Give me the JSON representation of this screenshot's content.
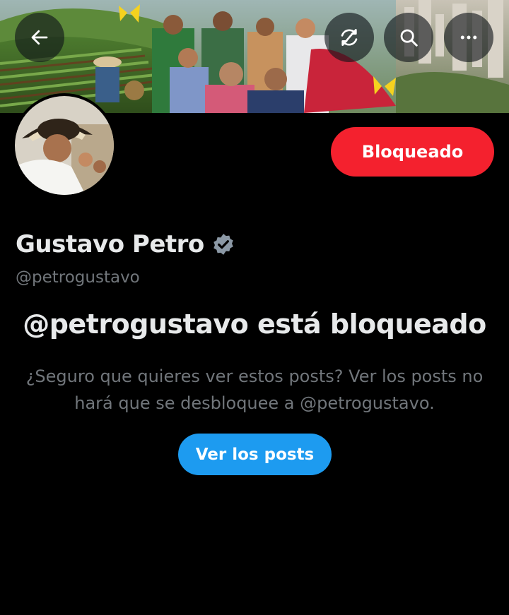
{
  "header": {
    "back_icon": "arrow-left-icon",
    "refresh_icon": "refresh-slash-icon",
    "search_icon": "search-icon",
    "more_icon": "more-horizontal-icon"
  },
  "profile": {
    "name": "Gustavo Petro",
    "handle": "@petrogustavo",
    "verified": true,
    "verified_color": "#8b98a5"
  },
  "actions": {
    "blocked_label": "Bloqueado",
    "blocked_color": "#f4212e"
  },
  "blocked_notice": {
    "title": "@petrogustavo está bloqueado",
    "description": "¿Seguro que quieres ver estos posts? Ver los posts no hará que se desbloquee a @petrogustavo.",
    "button_label": "Ver los posts",
    "button_color": "#1d9bf0"
  }
}
